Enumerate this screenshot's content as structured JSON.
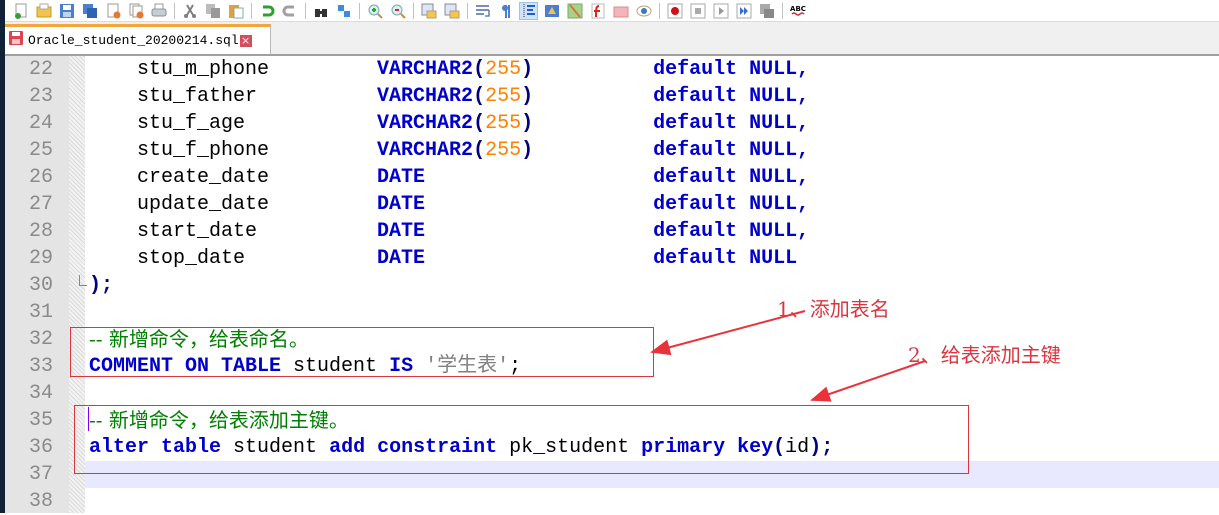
{
  "toolbar": {
    "buttons": [
      {
        "name": "new-file-icon",
        "glyph": "new"
      },
      {
        "name": "open-file-icon",
        "glyph": "open"
      },
      {
        "name": "save-icon",
        "glyph": "save"
      },
      {
        "name": "save-all-icon",
        "glyph": "saveall"
      },
      {
        "name": "close-icon",
        "glyph": "close"
      },
      {
        "name": "close-all-icon",
        "glyph": "closeall"
      },
      {
        "name": "print-icon",
        "glyph": "print"
      },
      {
        "sep": true
      },
      {
        "name": "cut-icon",
        "glyph": "cut"
      },
      {
        "name": "copy-icon",
        "glyph": "copy"
      },
      {
        "name": "paste-icon",
        "glyph": "paste"
      },
      {
        "sep": true
      },
      {
        "name": "undo-icon",
        "glyph": "undo"
      },
      {
        "name": "redo-icon",
        "glyph": "redo"
      },
      {
        "sep": true
      },
      {
        "name": "find-icon",
        "glyph": "find"
      },
      {
        "name": "replace-icon",
        "glyph": "replace"
      },
      {
        "sep": true
      },
      {
        "name": "zoom-in-icon",
        "glyph": "zoomin"
      },
      {
        "name": "zoom-out-icon",
        "glyph": "zoomout"
      },
      {
        "sep": true
      },
      {
        "name": "sync-vertical-icon",
        "glyph": "sync"
      },
      {
        "name": "sync-horizontal-icon",
        "glyph": "sync"
      },
      {
        "sep": true
      },
      {
        "name": "word-wrap-icon",
        "glyph": "wrap"
      },
      {
        "name": "show-all-chars-icon",
        "glyph": "pilcrow"
      },
      {
        "name": "indent-guide-icon",
        "glyph": "indent",
        "active": true
      },
      {
        "name": "user-language-icon",
        "glyph": "lang"
      },
      {
        "name": "document-map-icon",
        "glyph": "map"
      },
      {
        "name": "function-list-icon",
        "glyph": "func"
      },
      {
        "name": "folder-workspace-icon",
        "glyph": "folder"
      },
      {
        "name": "monitoring-icon",
        "glyph": "eye"
      },
      {
        "sep": true
      },
      {
        "name": "record-macro-icon",
        "glyph": "record"
      },
      {
        "name": "stop-recording-icon",
        "glyph": "stop"
      },
      {
        "name": "playback-macro-icon",
        "glyph": "play"
      },
      {
        "name": "run-macro-multiple-icon",
        "glyph": "ffwd"
      },
      {
        "name": "save-macro-icon",
        "glyph": "savemacro"
      },
      {
        "sep": true
      },
      {
        "name": "spell-check-icon",
        "glyph": "abc",
        "text": "ABC"
      }
    ]
  },
  "tab": {
    "label": "Oracle_student_20200214.sql",
    "close": "×"
  },
  "editor": {
    "lines": [
      {
        "n": "22",
        "tokens": [
          [
            "id",
            "    stu_m_phone         "
          ],
          [
            "kw",
            "VARCHAR2"
          ],
          [
            "paren",
            "("
          ],
          [
            "num",
            "255"
          ],
          [
            "paren",
            ")"
          ],
          [
            "id",
            "          "
          ],
          [
            "kw",
            "default NULL,"
          ]
        ]
      },
      {
        "n": "23",
        "tokens": [
          [
            "id",
            "    stu_father          "
          ],
          [
            "kw",
            "VARCHAR2"
          ],
          [
            "paren",
            "("
          ],
          [
            "num",
            "255"
          ],
          [
            "paren",
            ")"
          ],
          [
            "id",
            "          "
          ],
          [
            "kw",
            "default NULL,"
          ]
        ]
      },
      {
        "n": "24",
        "tokens": [
          [
            "id",
            "    stu_f_age           "
          ],
          [
            "kw",
            "VARCHAR2"
          ],
          [
            "paren",
            "("
          ],
          [
            "num",
            "255"
          ],
          [
            "paren",
            ")"
          ],
          [
            "id",
            "          "
          ],
          [
            "kw",
            "default NULL,"
          ]
        ]
      },
      {
        "n": "25",
        "tokens": [
          [
            "id",
            "    stu_f_phone         "
          ],
          [
            "kw",
            "VARCHAR2"
          ],
          [
            "paren",
            "("
          ],
          [
            "num",
            "255"
          ],
          [
            "paren",
            ")"
          ],
          [
            "id",
            "          "
          ],
          [
            "kw",
            "default NULL,"
          ]
        ]
      },
      {
        "n": "26",
        "tokens": [
          [
            "id",
            "    create_date         "
          ],
          [
            "kw",
            "DATE"
          ],
          [
            "id",
            "                   "
          ],
          [
            "kw",
            "default NULL,"
          ]
        ]
      },
      {
        "n": "27",
        "tokens": [
          [
            "id",
            "    update_date         "
          ],
          [
            "kw",
            "DATE"
          ],
          [
            "id",
            "                   "
          ],
          [
            "kw",
            "default NULL,"
          ]
        ]
      },
      {
        "n": "28",
        "tokens": [
          [
            "id",
            "    start_date          "
          ],
          [
            "kw",
            "DATE"
          ],
          [
            "id",
            "                   "
          ],
          [
            "kw",
            "default NULL,"
          ]
        ]
      },
      {
        "n": "29",
        "tokens": [
          [
            "id",
            "    stop_date           "
          ],
          [
            "kw",
            "DATE"
          ],
          [
            "id",
            "                   "
          ],
          [
            "kw",
            "default NULL"
          ]
        ]
      },
      {
        "n": "30",
        "tokens": [
          [
            "paren",
            ");"
          ]
        ]
      },
      {
        "n": "31",
        "tokens": []
      },
      {
        "n": "32",
        "tokens": [
          [
            "cmt",
            "-- 新增命令，给表命名。"
          ]
        ]
      },
      {
        "n": "33",
        "tokens": [
          [
            "kw",
            "COMMENT ON TABLE"
          ],
          [
            "id",
            " student "
          ],
          [
            "kw",
            "IS"
          ],
          [
            "id",
            " "
          ],
          [
            "str",
            "'学生表'"
          ],
          [
            "id",
            ";"
          ]
        ]
      },
      {
        "n": "34",
        "tokens": []
      },
      {
        "n": "35",
        "tokens": [
          [
            "cmt",
            "-- 新增命令，给表添加主键。"
          ]
        ]
      },
      {
        "n": "36",
        "tokens": [
          [
            "kw",
            "alter table"
          ],
          [
            "id",
            " student "
          ],
          [
            "kw",
            "add constraint"
          ],
          [
            "id",
            " pk_student "
          ],
          [
            "kw",
            "primary key"
          ],
          [
            "paren",
            "("
          ],
          [
            "id",
            "id"
          ],
          [
            "paren",
            ");"
          ]
        ]
      },
      {
        "n": "37",
        "tokens": [],
        "current": true
      },
      {
        "n": "38",
        "tokens": []
      }
    ]
  },
  "annotations": {
    "label1": "1、添加表名",
    "label2": "2、给表添加主键",
    "color": "#d9363e"
  }
}
